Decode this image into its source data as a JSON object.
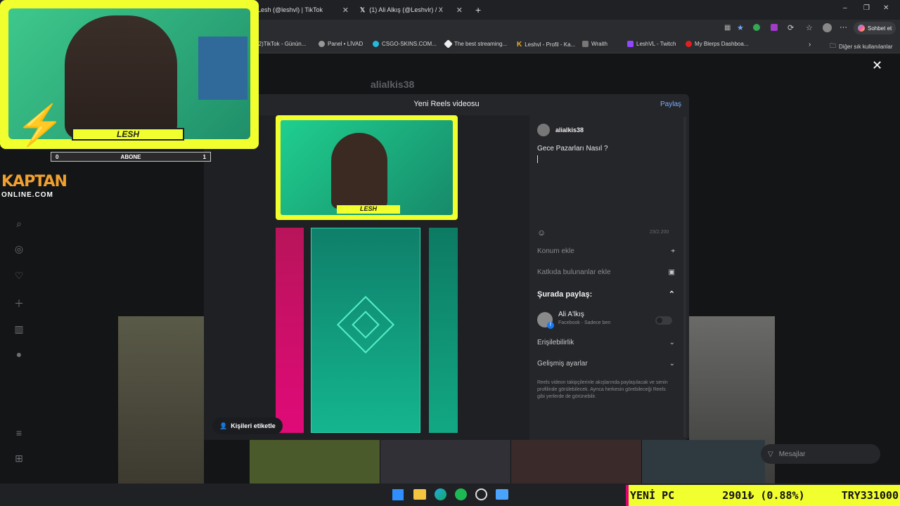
{
  "tabs": [
    {
      "title": "Lesh (@leshvl) | TikTok"
    },
    {
      "title": "(1) Ali Alkış (@Leshvlr) / X"
    }
  ],
  "window": {
    "add_tab": "+",
    "minimize": "–",
    "restore": "❐",
    "close": "✕",
    "menu": "⋯",
    "chat_button": "Sohbet et"
  },
  "bookmarks": [
    {
      "label": "(2)TikTok - Günün..."
    },
    {
      "label": "Panel • LİVAD"
    },
    {
      "label": "CSGO-SKINS.COM..."
    },
    {
      "label": "The best streaming..."
    },
    {
      "label": "Leshvl - Profil - Ka..."
    },
    {
      "label": "Wraith"
    },
    {
      "label": "LeshVL - Twitch"
    },
    {
      "label": "My Blerps Dashboa..."
    }
  ],
  "other_bookmarks": "Diğer sık kullanılanlar",
  "profile": {
    "username": "alialkis38"
  },
  "modal": {
    "title": "Yeni Reels videosu",
    "share_label": "Paylaş",
    "tag_people": "Kişileri etiketle",
    "caption": "Gece Pazarları Nasıl ?",
    "char_count": "23/2.200",
    "add_location": "Konum ekle",
    "add_collaborators": "Katkıda bulunanlar ekle",
    "share_to_heading": "Şurada paylaş:",
    "account_name": "Ali A'lkış",
    "account_meta": "Facebook · Sadece ben",
    "accessibility": "Erişilebilirlik",
    "advanced_settings": "Gelişmiş ayarlar",
    "info_text": "Reels videon takipçilerinle akışlarında paylaşılacak ve senin profilinde görülebilecek. Ayrıca herkesin görebileceği Reels gibi yerlerde de görünebilir."
  },
  "messages_label": "Mesajlar",
  "overlay": {
    "name_plate": "LESH",
    "abone_label": "ABONE",
    "abone_left": "0",
    "abone_right": "1",
    "brand_top": "KAPTAN",
    "brand_bottom": "ONLINE.COM"
  },
  "ticker": {
    "label": "YENİ PC",
    "price": "2901₺ (0.88%)",
    "code": "TRY331000"
  },
  "colors": {
    "accent_yellow": "#f2ff2f",
    "link_blue": "#7ab0ff",
    "ticker_pink": "#e0007a"
  }
}
